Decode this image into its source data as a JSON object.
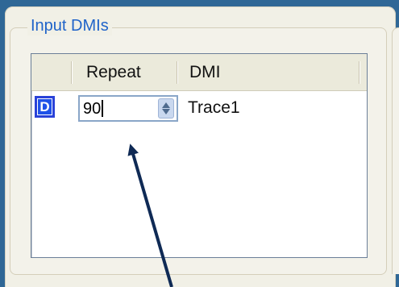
{
  "group": {
    "title": "Input DMIs"
  },
  "table": {
    "columns": [
      {
        "label": ""
      },
      {
        "label": "Repeat"
      },
      {
        "label": "DMI"
      }
    ],
    "rows": [
      {
        "indicator": "D",
        "repeat": "90",
        "dmi": "Trace1"
      }
    ]
  },
  "icons": {
    "spinner": "spinner-icon",
    "arrow": "arrow-pointer"
  },
  "colors": {
    "background_blue": "#2f6796",
    "title_blue": "#1f63c9",
    "indicator_blue": "#1f52e8",
    "arrow_navy": "#0f2a55"
  }
}
